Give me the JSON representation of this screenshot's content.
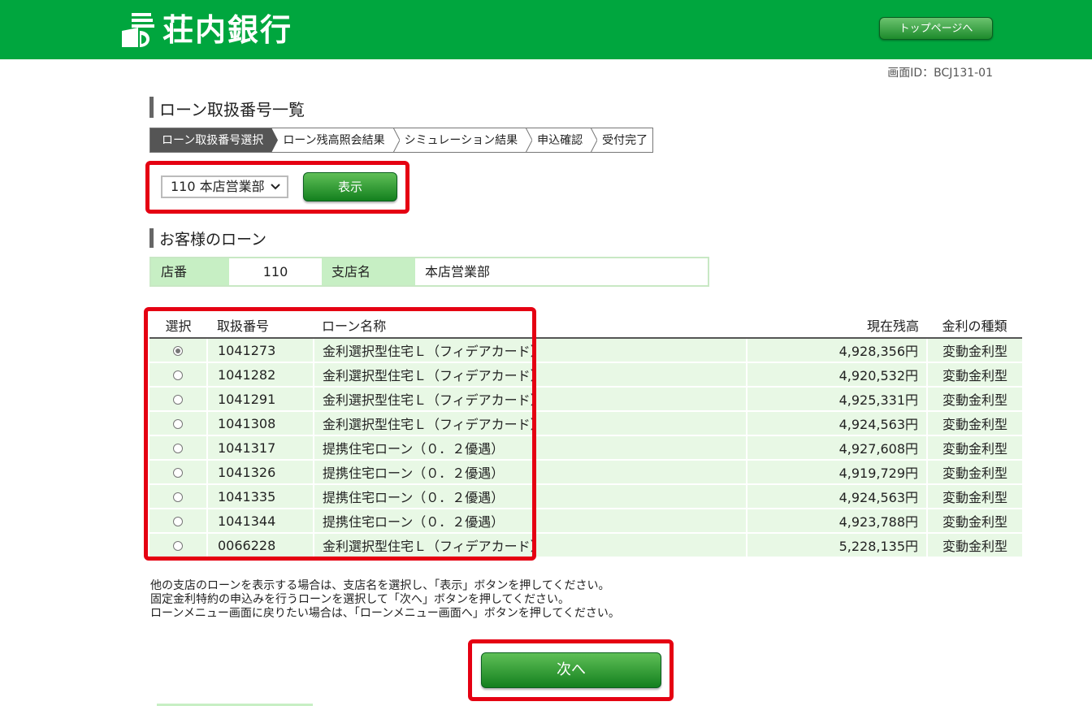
{
  "header": {
    "bank_name": "荘内銀行",
    "top_page_button": "トップページへ"
  },
  "screen_id": "画面ID：BCJ131-01",
  "page_title": "ローン取扱番号一覧",
  "steps": [
    "ローン取扱番号選択",
    "ローン残高照会結果",
    "シミュレーション結果",
    "申込確認",
    "受付完了"
  ],
  "branch_select": {
    "value": "110 本店営業部",
    "display_button": "表示"
  },
  "customer_section": {
    "title": "お客様のローン",
    "branch_no_label": "店番",
    "branch_no": "110",
    "branch_name_label": "支店名",
    "branch_name": "本店営業部"
  },
  "loan_table": {
    "headers": {
      "select": "選択",
      "number": "取扱番号",
      "name": "ローン名称",
      "balance": "現在残高",
      "rate_type": "金利の種類"
    },
    "rows": [
      {
        "number": "1041273",
        "name": "金利選択型住宅Ｌ（フィデアカード）",
        "balance": "4,928,356円",
        "rate_type": "変動金利型",
        "selected": true
      },
      {
        "number": "1041282",
        "name": "金利選択型住宅Ｌ（フィデアカード）",
        "balance": "4,920,532円",
        "rate_type": "変動金利型",
        "selected": false
      },
      {
        "number": "1041291",
        "name": "金利選択型住宅Ｌ（フィデアカード）",
        "balance": "4,925,331円",
        "rate_type": "変動金利型",
        "selected": false
      },
      {
        "number": "1041308",
        "name": "金利選択型住宅Ｌ（フィデアカード）",
        "balance": "4,924,563円",
        "rate_type": "変動金利型",
        "selected": false
      },
      {
        "number": "1041317",
        "name": "提携住宅ローン（０．２優遇）",
        "balance": "4,927,608円",
        "rate_type": "変動金利型",
        "selected": false
      },
      {
        "number": "1041326",
        "name": "提携住宅ローン（０．２優遇）",
        "balance": "4,919,729円",
        "rate_type": "変動金利型",
        "selected": false
      },
      {
        "number": "1041335",
        "name": "提携住宅ローン（０．２優遇）",
        "balance": "4,924,563円",
        "rate_type": "変動金利型",
        "selected": false
      },
      {
        "number": "1041344",
        "name": "提携住宅ローン（０．２優遇）",
        "balance": "4,923,788円",
        "rate_type": "変動金利型",
        "selected": false
      },
      {
        "number": "0066228",
        "name": "金利選択型住宅Ｌ（フィデアカード）",
        "balance": "5,228,135円",
        "rate_type": "変動金利型",
        "selected": false
      }
    ]
  },
  "notes": [
    "他の支店のローンを表示する場合は、支店名を選択し、「表示」ボタンを押してください。",
    "固定金利特約の申込みを行うローンを選択して「次へ」ボタンを押してください。",
    "ローンメニュー画面に戻りたい場合は、「ローンメニュー画面へ」ボタンを押してください。"
  ],
  "next_button": "次へ",
  "colors": {
    "brand_green": "#00a63e",
    "highlight_red": "#e50012",
    "row_green": "#e8f8e5",
    "label_green": "#c7efc4"
  }
}
